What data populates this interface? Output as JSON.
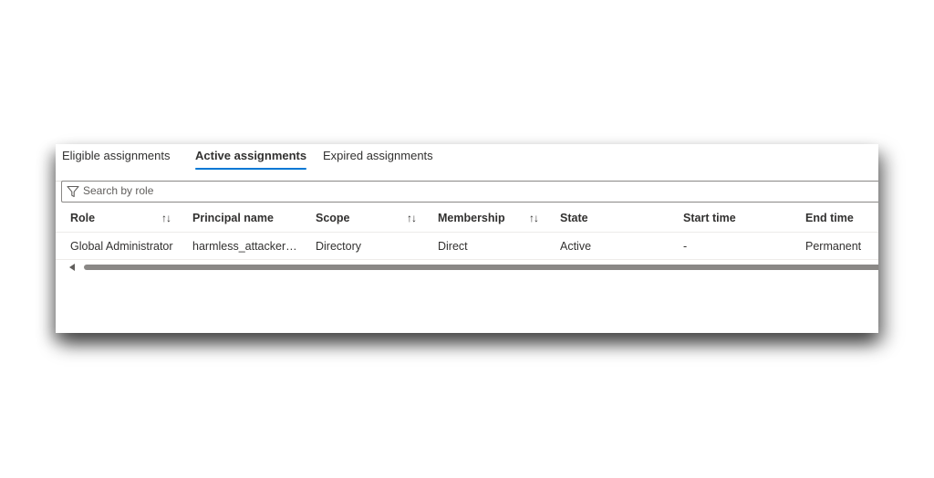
{
  "tabs": [
    {
      "label": "Eligible assignments",
      "active": false
    },
    {
      "label": "Active assignments",
      "active": true
    },
    {
      "label": "Expired assignments",
      "active": false
    }
  ],
  "search": {
    "placeholder": "Search by role",
    "value": "",
    "icon": "filter-icon"
  },
  "table": {
    "columns": [
      "Role",
      "Principal name",
      "Scope",
      "Membership",
      "State",
      "Start time",
      "End time"
    ],
    "sortable": [
      "Role",
      "Scope",
      "Membership"
    ],
    "sort_icon": "↑↓",
    "rows": [
      [
        "Global Administrator",
        "harmless_attacker@...",
        "Directory",
        "Direct",
        "Active",
        "-",
        "Permanent"
      ]
    ]
  },
  "colors": {
    "accent": "#0078d4",
    "text": "#323130",
    "border": "#8a8886"
  }
}
